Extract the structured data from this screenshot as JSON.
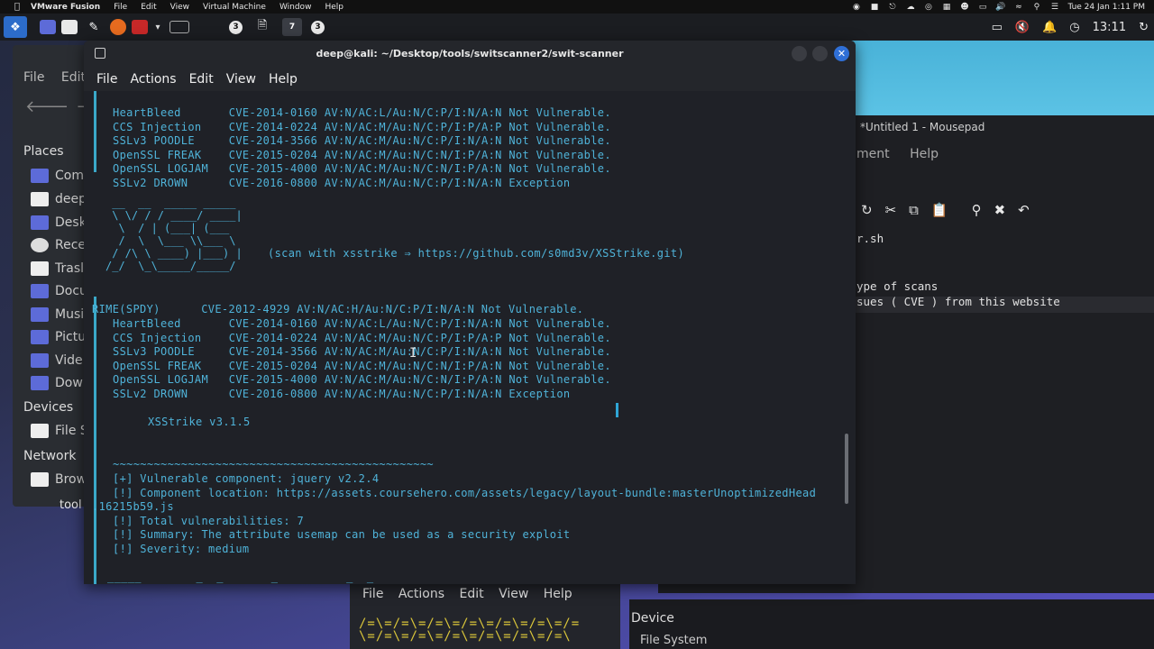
{
  "host_menubar": {
    "app_name": "VMware Fusion",
    "items": [
      "File",
      "Edit",
      "View",
      "Virtual Machine",
      "Window",
      "Help"
    ],
    "datetime": "Tue 24 Jan  1:11 PM"
  },
  "guest_panel": {
    "workspaces": [
      "3",
      "7",
      "3"
    ],
    "clock": "13:11"
  },
  "file_manager": {
    "menu": [
      "File",
      "Edit"
    ],
    "places_header": "Places",
    "places": [
      "Com",
      "deep",
      "Desk",
      "Rece",
      "Trasl",
      "Docu",
      "Musi",
      "Pictu",
      "Vide",
      "Dowr"
    ],
    "devices_header": "Devices",
    "devices": [
      "File S"
    ],
    "network_header": "Network",
    "network": [
      "Brow"
    ],
    "desktop_label": "tool"
  },
  "mousepad": {
    "title": "*Untitled 1 - Mousepad",
    "menu": [
      "ment",
      "Help"
    ],
    "lines": [
      "r.sh",
      "",
      "",
      "ype of scans",
      "sues ( CVE ) from this website"
    ]
  },
  "bottom_terminal": {
    "menu": [
      "File",
      "Actions",
      "Edit",
      "View",
      "Help"
    ],
    "device_label": "Device",
    "device_item": "File System"
  },
  "terminal": {
    "title": "deep@kali: ~/Desktop/tools/switscanner2/swit-scanner",
    "menu": [
      "File",
      "Actions",
      "Edit",
      "View",
      "Help"
    ],
    "block1": [
      "HeartBleed       CVE-2014-0160 AV:N/AC:L/Au:N/C:P/I:N/A:N Not Vulnerable.",
      "CCS Injection    CVE-2014-0224 AV:N/AC:M/Au:N/C:P/I:P/A:P Not Vulnerable.",
      "SSLv3 POODLE     CVE-2014-3566 AV:N/AC:M/Au:N/C:P/I:N/A:N Not Vulnerable.",
      "OpenSSL FREAK    CVE-2015-0204 AV:N/AC:M/Au:N/C:N/I:P/A:N Not Vulnerable.",
      "OpenSSL LOGJAM   CVE-2015-4000 AV:N/AC:M/Au:N/C:N/I:P/A:N Not Vulnerable.",
      "SSLv2 DROWN      CVE-2016-0800 AV:N/AC:M/Au:N/C:P/I:N/A:N Exception"
    ],
    "xss_art": [
      " __  __  _____ _____",
      " \\ \\/ / / ____/ ____|",
      "  \\  / | (___| (___",
      "  /  \\  \\___ \\\\___ \\",
      " / /\\ \\ ____) |___) |",
      "/_/  \\_\\_____/_____/"
    ],
    "xss_note": "(scan with xsstrike ⇒ https://github.com/s0md3v/XSStrike.git)",
    "crime_line": "RIME(SPDY)      CVE-2012-4929 AV:N/AC:H/Au:N/C:P/I:N/A:N Not Vulnerable.",
    "block2": [
      "HeartBleed       CVE-2014-0160 AV:N/AC:L/Au:N/C:P/I:N/A:N Not Vulnerable.",
      "CCS Injection    CVE-2014-0224 AV:N/AC:M/Au:N/C:P/I:P/A:P Not Vulnerable.",
      "SSLv3 POODLE     CVE-2014-3566 AV:N/AC:M/Au:N/C:P/I:N/A:N Not Vulnerable.",
      "OpenSSL FREAK    CVE-2015-0204 AV:N/AC:M/Au:N/C:N/I:P/A:N Not Vulnerable.",
      "OpenSSL LOGJAM   CVE-2015-4000 AV:N/AC:M/Au:N/C:N/I:P/A:N Not Vulnerable.",
      "SSLv2 DROWN      CVE-2016-0800 AV:N/AC:M/Au:N/C:P/I:N/A:N Exception"
    ],
    "xsstrike_version": "XSStrike v3.1.5",
    "separator": "~~~~~~~~~~~~~~~~~~~~~~~~~~~~~~~~~~~~~~~~~~~~~~~",
    "vuln_component": "[+] Vulnerable component: jquery v2.2.4",
    "component_location": "[!] Component location: https://assets.coursehero.com/assets/legacy/layout-bundle:masterUnoptimizedHead",
    "component_location_cont": ".16215b59.js",
    "total": "[!] Total vulnerabilities: 7",
    "summary": "[!] Summary: The attribute usemap can be used as a security exploit",
    "severity": "[!] Severity: medium",
    "trailing": "_____        _  _       _          _  _"
  },
  "colors": {
    "terminal_text": "#4fb3d9",
    "terminal_bg": "#1f2127",
    "accent": "#2f6fd6"
  }
}
